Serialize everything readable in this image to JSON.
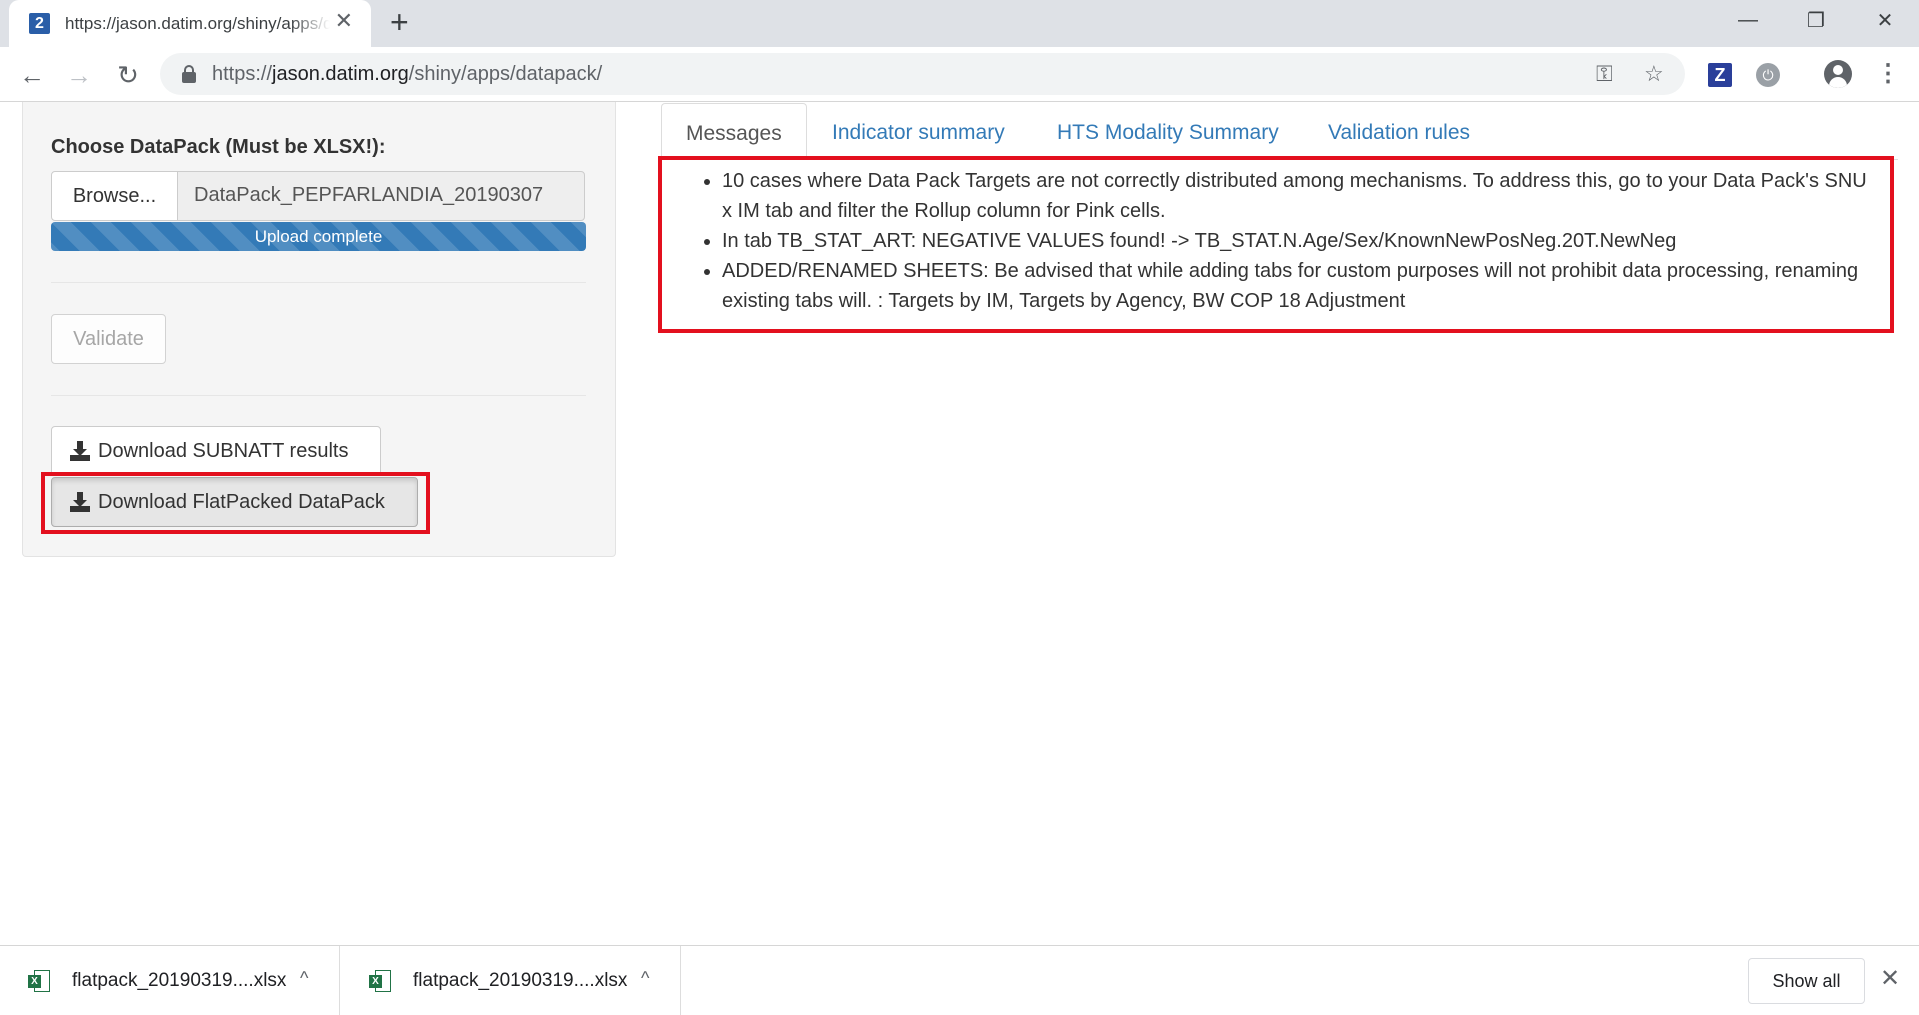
{
  "browser": {
    "tab_favicon": "2",
    "tab_title": "https://jason.datim.org/shiny/apps/datapack/",
    "tab_close": "✕",
    "new_tab": "+",
    "window_minimize": "—",
    "window_restore": "❐",
    "window_close": "✕",
    "back_icon": "←",
    "forward_icon": "→",
    "reload_icon": "↻",
    "url_scheme": "https://",
    "url_host": "jason.datim.org",
    "url_path": "/shiny/apps/datapack/",
    "key_icon": "⚿",
    "star_icon": "☆",
    "ext_z": "Z",
    "ext_power": "⏻",
    "menu_icon": "⋮"
  },
  "sidebar": {
    "file_label": "Choose DataPack (Must be XLSX!):",
    "browse_label": "Browse...",
    "file_name": "DataPack_PEPFARLANDIA_20190307",
    "upload_status": "Upload complete",
    "upload_progress_percent": 100,
    "validate_label": "Validate",
    "download_subnatt_label": "Download SUBNATT results",
    "download_flatpack_label": "Download FlatPacked DataPack"
  },
  "tabs": [
    {
      "label": "Messages",
      "active": true
    },
    {
      "label": "Indicator summary",
      "active": false
    },
    {
      "label": "HTS Modality Summary",
      "active": false
    },
    {
      "label": "Validation rules",
      "active": false
    }
  ],
  "messages": [
    "10 cases where Data Pack Targets are not correctly distributed among mechanisms. To address this, go to your Data Pack's SNU x IM tab and filter the Rollup column for Pink cells.",
    "In tab TB_STAT_ART: NEGATIVE VALUES found! -> TB_STAT.N.Age/Sex/KnownNewPosNeg.20T.NewNeg",
    "ADDED/RENAMED SHEETS: Be advised that while adding tabs for custom purposes will not prohibit data processing, renaming existing tabs will. : Targets by IM, Targets by Agency, BW COP 18 Adjustment"
  ],
  "downloads": {
    "items": [
      {
        "name": "flatpack_20190319....xlsx",
        "caret": "^"
      },
      {
        "name": "flatpack_20190319....xlsx",
        "caret": "^"
      }
    ],
    "excel_badge": "X",
    "show_all_label": "Show all",
    "close_icon": "✕"
  },
  "colors": {
    "highlight_red": "#e3101e",
    "link_blue": "#337ab7",
    "progress_blue": "#337ab7",
    "excel_green": "#217346"
  }
}
